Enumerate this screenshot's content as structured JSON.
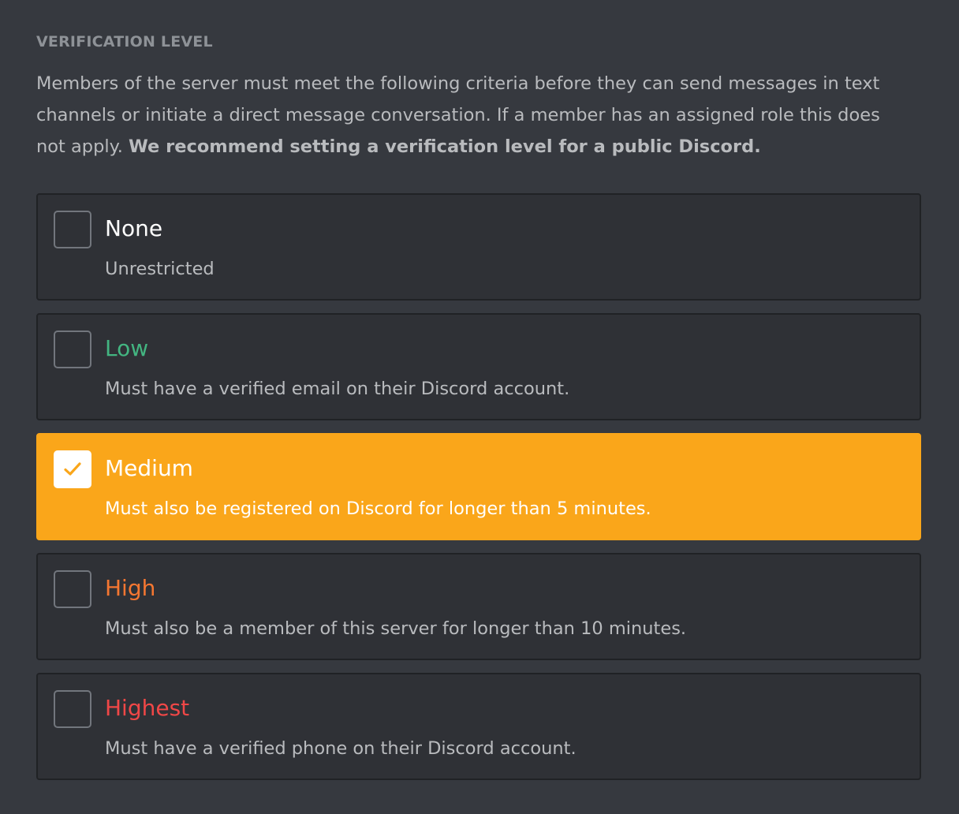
{
  "section": {
    "title": "VERIFICATION LEVEL",
    "description": "Members of the server must meet the following criteria before they can send messages in text channels or initiate a direct message conversation. If a member has an assigned role this does not apply.",
    "recommendation": "We recommend setting a verification level for a public Discord."
  },
  "options": [
    {
      "label": "None",
      "description": "Unrestricted",
      "label_color": "#ffffff",
      "checked": false
    },
    {
      "label": "Low",
      "description": "Must have a verified email on their Discord account.",
      "label_color": "#43b581",
      "checked": false
    },
    {
      "label": "Medium",
      "description": "Must also be registered on Discord for longer than 5 minutes.",
      "label_color": "#ffffff",
      "checked": true
    },
    {
      "label": "High",
      "description": "Must also be a member of this server for longer than 10 minutes.",
      "label_color": "#f57731",
      "checked": false
    },
    {
      "label": "Highest",
      "description": "Must have a verified phone on their Discord account.",
      "label_color": "#f04747",
      "checked": false
    }
  ],
  "colors": {
    "background": "#36393f",
    "option_background": "#2f3136",
    "option_border": "#202225",
    "selected_background": "#faa61a",
    "checkmark": "#faa61a",
    "checkbox_border": "#72767d"
  },
  "icons": {
    "checked": "checkmark-icon"
  }
}
